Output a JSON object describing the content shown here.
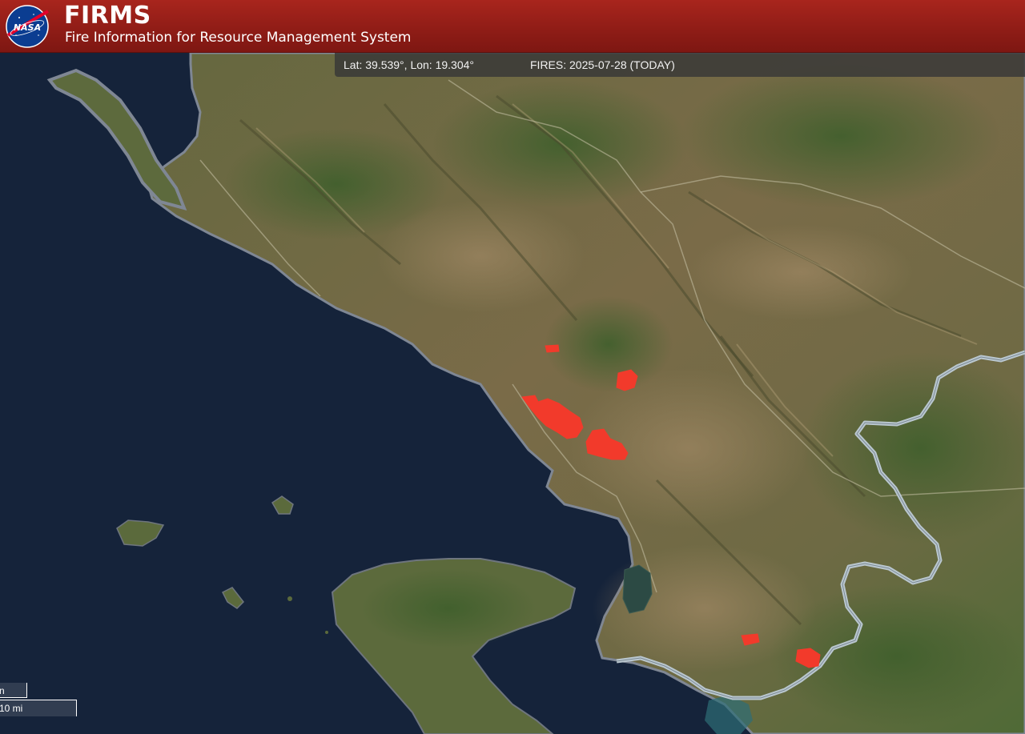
{
  "header": {
    "logo_text": "NASA",
    "title": "FIRMS",
    "subtitle": "Fire Information for Resource Management System"
  },
  "status_bar": {
    "coordinates": "Lat: 39.539°, Lon: 19.304°",
    "fires_label": "FIRES: 2025-07-28 (TODAY)"
  },
  "scale": {
    "km_label": "n",
    "mi_label": "10 mi"
  },
  "colors": {
    "header": "#9a2019",
    "fire": "#f23a2b",
    "sea": "#15233a",
    "land": "#6e6640",
    "border": "#b8c3cc"
  },
  "icons": {
    "logo": "nasa-meatball-icon"
  }
}
